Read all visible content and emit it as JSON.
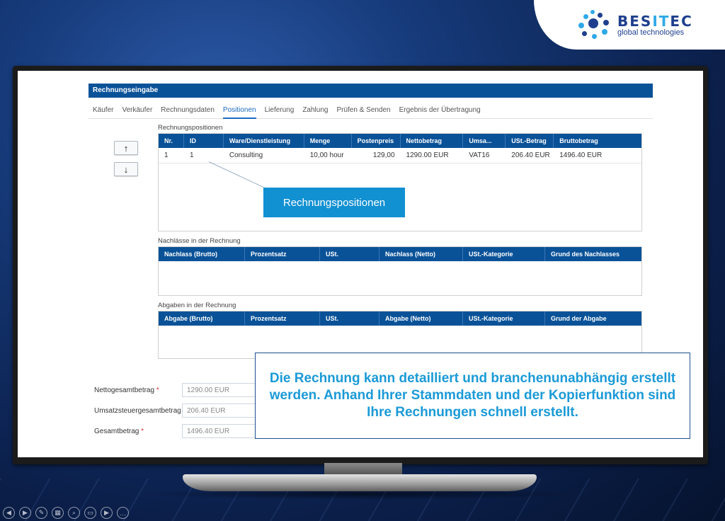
{
  "brand": {
    "name_pre": "BES",
    "name_it": "IT",
    "name_post": "EC",
    "sub": "global technologies",
    "accent": "#2fa8e8",
    "primary": "#1f3f8e"
  },
  "app": {
    "title": "Rechnungseingabe",
    "tabs": [
      "Käufer",
      "Verkäufer",
      "Rechnungsdaten",
      "Positionen",
      "Lieferung",
      "Zahlung",
      "Prüfen & Senden",
      "Ergebnis der Übertragung"
    ],
    "active_tab": "Positionen",
    "up_label": "↑",
    "down_label": "↓",
    "positions": {
      "label": "Rechnungspositionen",
      "columns": [
        "Nr.",
        "ID",
        "Ware/Dienstleistung",
        "Menge",
        "Postenpreis",
        "Nettobetrag",
        "Umsa...",
        "USt.-Betrag",
        "Bruttobetrag"
      ],
      "rows": [
        [
          "1",
          "1",
          "Consulting",
          "10,00 hour",
          "129,00",
          "1290.00 EUR",
          "VAT16",
          "206.40 EUR",
          "1496.40 EUR"
        ]
      ]
    },
    "callout": "Rechnungspositionen",
    "discounts": {
      "label": "Nachlässe in der Rechnung",
      "columns": [
        "Nachlass (Brutto)",
        "Prozentsatz",
        "USt.",
        "Nachlass (Netto)",
        "USt.-Kategorie",
        "Grund des Nachlasses"
      ]
    },
    "charges": {
      "label": "Abgaben in der Rechnung",
      "columns": [
        "Abgabe (Brutto)",
        "Prozentsatz",
        "USt.",
        "Abgabe (Netto)",
        "USt.-Kategorie",
        "Grund der Abgabe"
      ]
    },
    "totals": {
      "net_label": "Nettogesamtbetrag",
      "net_value": "1290.00 EUR",
      "vat_label": "Umsatzsteuergesamtbetrag",
      "vat_value": "206.40 EUR",
      "gross_label": "Gesamtbetrag",
      "gross_value": "1496.40 EUR",
      "required_mark": "*"
    }
  },
  "info_text": "Die Rechnung kann detailliert und branchenunabhängig erstellt werden. Anhand Ihrer Stammdaten und der Kopierfunktion sind Ihre Rechnungen schnell erstellt.",
  "bottom_icons": [
    "◀",
    "▶",
    "✎",
    "▦",
    "⌕",
    "▭",
    "▶",
    "…"
  ]
}
